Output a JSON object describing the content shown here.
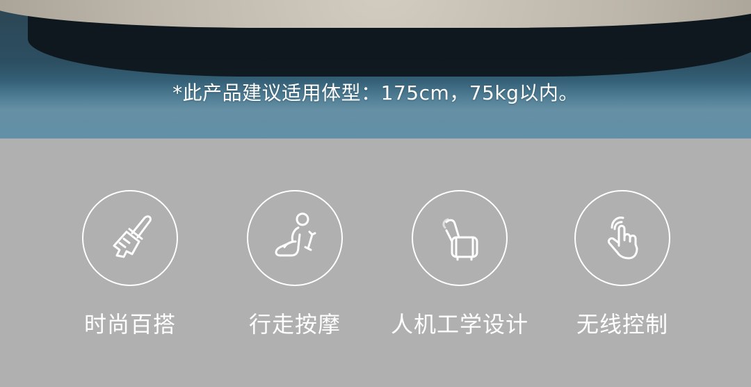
{
  "hero": {
    "notice": "*此产品建议适用体型：175cm，75kg以内。"
  },
  "features": [
    {
      "label": "时尚百搭",
      "icon": "paintbrush-icon"
    },
    {
      "label": "行走按摩",
      "icon": "massage-person-icon"
    },
    {
      "label": "人机工学设计",
      "icon": "recliner-chair-icon"
    },
    {
      "label": "无线控制",
      "icon": "touch-hand-icon"
    }
  ],
  "colors": {
    "background": "#b0b0b0",
    "icon_stroke": "#ffffff",
    "text": "#ffffff"
  }
}
